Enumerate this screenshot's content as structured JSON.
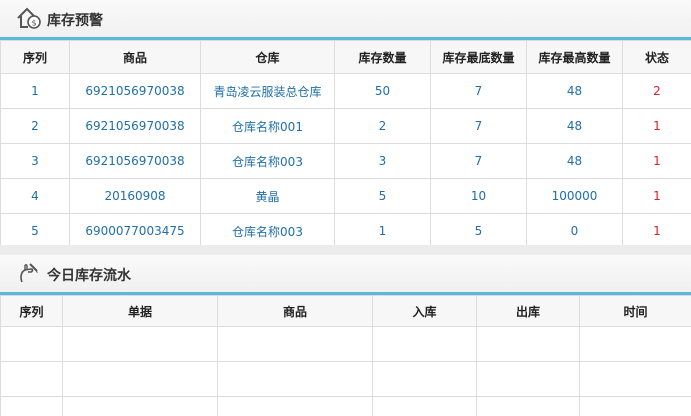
{
  "colors": {
    "accent": "#5bb8d6",
    "link": "#1f6fa8",
    "alert": "#d9202a"
  },
  "alert_panel": {
    "icon": "house-money-icon",
    "title": "库存预警",
    "columns": [
      "序列",
      "商品",
      "仓库",
      "库存数量",
      "库存最底数量",
      "库存最高数量",
      "状态"
    ],
    "rows": [
      {
        "seq": "1",
        "product": "6921056970038",
        "warehouse": "青岛凌云服装总仓库",
        "qty": "50",
        "min": "7",
        "max": "48",
        "status": "2"
      },
      {
        "seq": "2",
        "product": "6921056970038",
        "warehouse": "仓库名称001",
        "qty": "2",
        "min": "7",
        "max": "48",
        "status": "1"
      },
      {
        "seq": "3",
        "product": "6921056970038",
        "warehouse": "仓库名称003",
        "qty": "3",
        "min": "7",
        "max": "48",
        "status": "1"
      },
      {
        "seq": "4",
        "product": "20160908",
        "warehouse": "黄晶",
        "qty": "5",
        "min": "10",
        "max": "100000",
        "status": "1"
      },
      {
        "seq": "5",
        "product": "6900077003475",
        "warehouse": "仓库名称003",
        "qty": "1",
        "min": "5",
        "max": "0",
        "status": "1"
      }
    ]
  },
  "flow_panel": {
    "icon": "hand-pen-icon",
    "title": "今日库存流水",
    "columns": [
      "序列",
      "单据",
      "商品",
      "入库",
      "出库",
      "时间"
    ]
  }
}
